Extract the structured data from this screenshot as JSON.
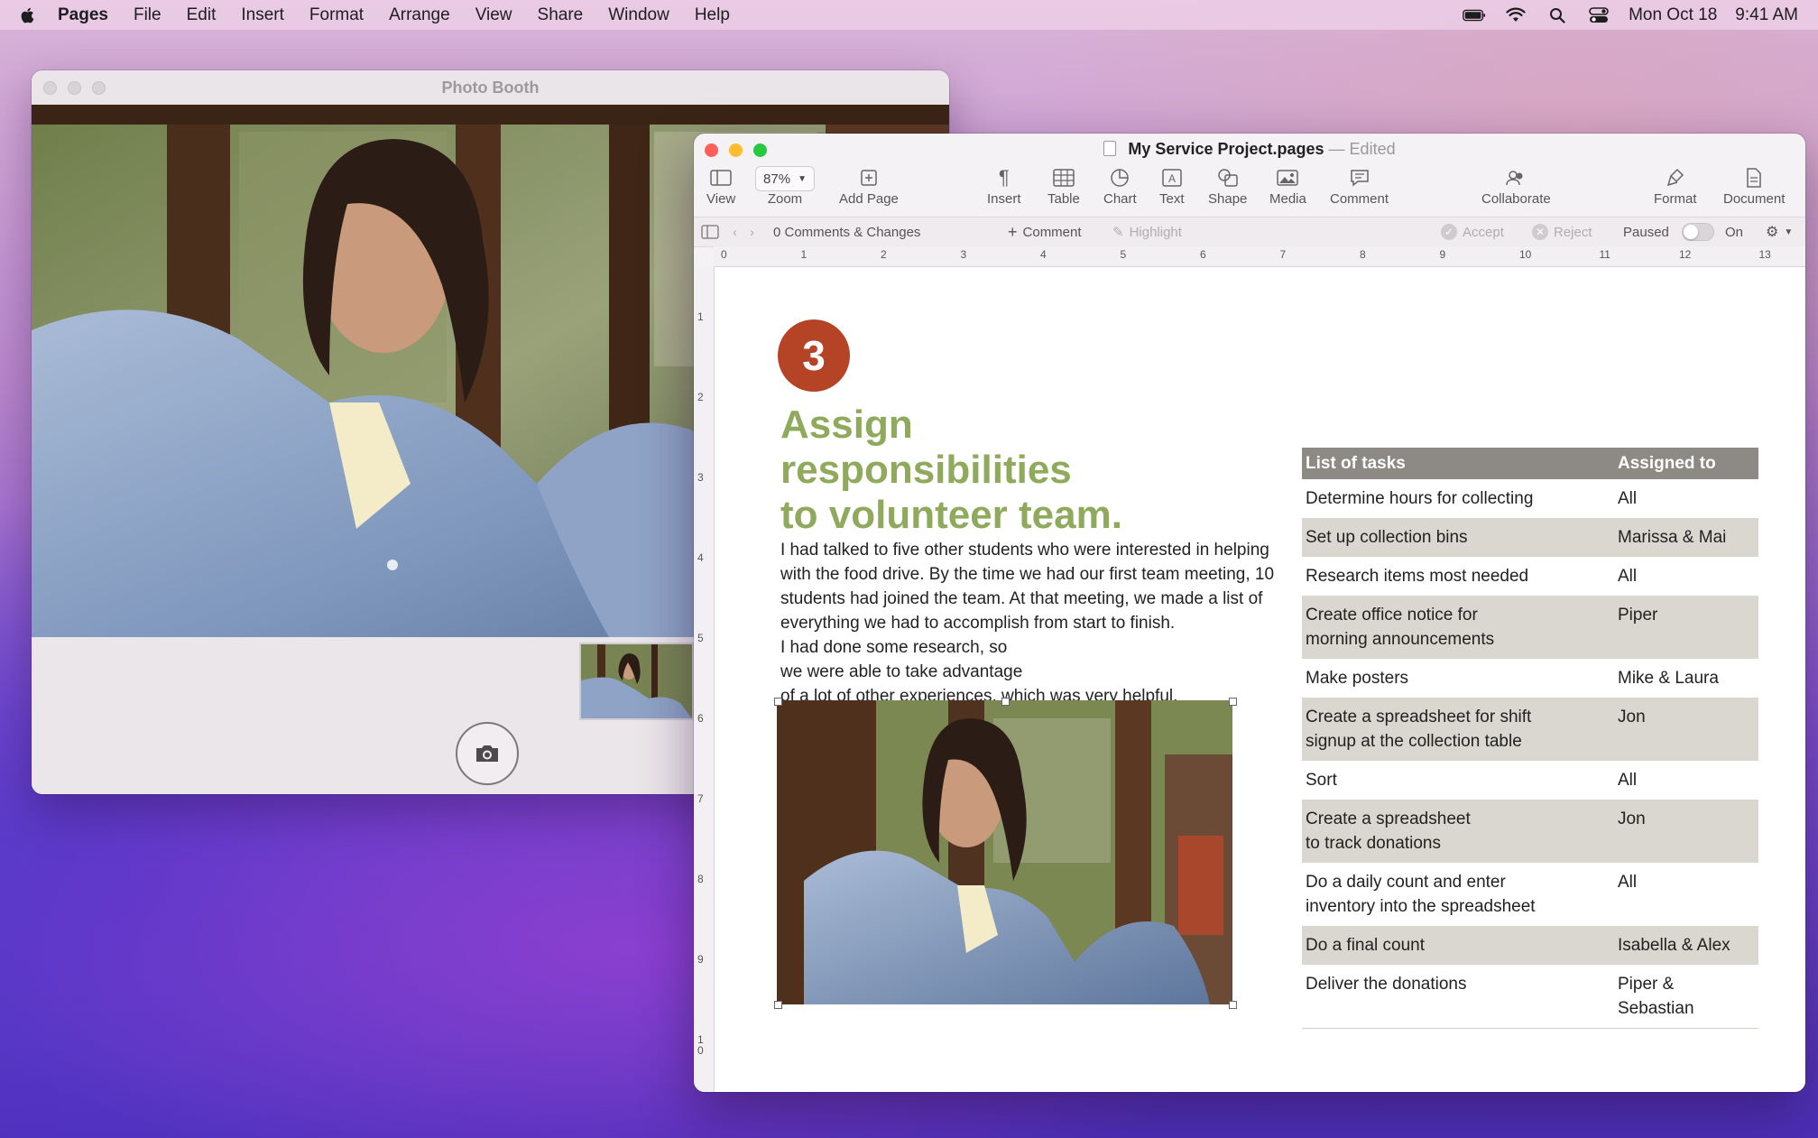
{
  "menubar": {
    "app": "Pages",
    "items": [
      "File",
      "Edit",
      "Insert",
      "Format",
      "Arrange",
      "View",
      "Share",
      "Window",
      "Help"
    ],
    "date": "Mon Oct 18",
    "time": "9:41 AM"
  },
  "photobooth": {
    "title": "Photo Booth"
  },
  "pages": {
    "title": "My Service Project.pages",
    "separator": "—",
    "status": "Edited",
    "toolbar": {
      "view": "View",
      "zoom_value": "87%",
      "zoom": "Zoom",
      "add_page": "Add Page",
      "insert": "Insert",
      "table": "Table",
      "chart": "Chart",
      "text": "Text",
      "shape": "Shape",
      "media": "Media",
      "comment": "Comment",
      "collaborate": "Collaborate",
      "format": "Format",
      "document": "Document"
    },
    "review": {
      "comments_changes": "0 Comments & Changes",
      "comment": "Comment",
      "highlight": "Highlight",
      "accept": "Accept",
      "reject": "Reject",
      "paused": "Paused",
      "on": "On"
    },
    "ruler": [
      "0",
      "1",
      "2",
      "3",
      "4",
      "5",
      "6",
      "7",
      "8",
      "9",
      "10",
      "11",
      "12",
      "13"
    ],
    "vruler": [
      "1",
      "2",
      "3",
      "4",
      "5",
      "6",
      "7",
      "8",
      "9",
      "1\n0"
    ],
    "doc": {
      "step_number": "3",
      "heading_line1": "Assign responsibilities",
      "heading_line2": "to volunteer team.",
      "paragraph1": "I had talked to five other students who were interested in helping with the food drive. By the time we had our first team meeting, 10 students had joined the team. At that meeting, we made a list of everything we had to accomplish from start to finish.",
      "line2": "I had done some research, so",
      "line3": "we were able to take advantage",
      "line4": "of a lot of other experiences, which was very helpful.",
      "table": {
        "headers": [
          "List of tasks",
          "Assigned to"
        ],
        "rows": [
          {
            "task": "Determine hours for collecting",
            "who": "All"
          },
          {
            "task": "Set up collection bins",
            "who": "Marissa & Mai"
          },
          {
            "task": "Research items most needed",
            "who": "All"
          },
          {
            "task": "Create office notice for\nmorning announcements",
            "who": "Piper"
          },
          {
            "task": "Make posters",
            "who": "Mike & Laura"
          },
          {
            "task": "Create a spreadsheet for shift\nsignup at the collection table",
            "who": "Jon"
          },
          {
            "task": "Sort",
            "who": "All"
          },
          {
            "task": "Create a spreadsheet\nto track donations",
            "who": "Jon"
          },
          {
            "task": "Do a daily count and enter\ninventory into the spreadsheet",
            "who": "All"
          },
          {
            "task": "Do a final count",
            "who": "Isabella & Alex"
          },
          {
            "task": "Deliver the donations",
            "who": "Piper &\nSebastian"
          }
        ]
      }
    }
  },
  "colors": {
    "heading_green": "#8faa5c",
    "badge_red": "#b54427",
    "table_header": "#8d8a85",
    "table_shade": "#dad7d0"
  }
}
